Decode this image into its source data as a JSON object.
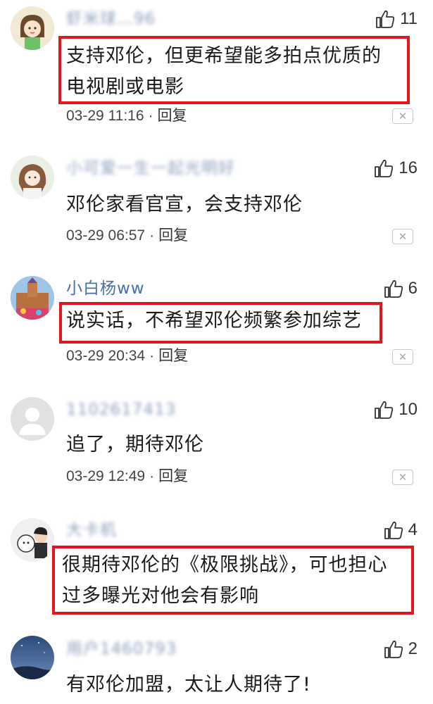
{
  "comments": [
    {
      "username": "虾米球…96",
      "username_blurred": true,
      "likes": "11",
      "text": "支持邓伦，但更希望能多拍点优质的电视剧或电影",
      "date": "03-29 11:16",
      "reply": "回复",
      "highlighted": true,
      "avatar_icon": "cartoon-girl-avatar-icon"
    },
    {
      "username": "小可爱一生一起光明好",
      "username_blurred": true,
      "likes": "16",
      "text": "邓伦家看官宣，会支持邓伦",
      "date": "03-29 06:57",
      "reply": "回复",
      "highlighted": false,
      "avatar_icon": "anime-girl-avatar-icon"
    },
    {
      "username": "小白杨ww",
      "username_blurred": false,
      "likes": "6",
      "text": "说实话，不希望邓伦频繁参加综艺",
      "date": "03-29 20:34",
      "reply": "回复",
      "highlighted": true,
      "avatar_icon": "castle-photo-avatar-icon"
    },
    {
      "username": "1102617413",
      "username_blurred": true,
      "likes": "10",
      "text": "追了，期待邓伦",
      "date": "03-29 12:49",
      "reply": "回复",
      "highlighted": false,
      "avatar_icon": "default-user-avatar-icon"
    },
    {
      "username": "大卡机",
      "username_blurred": true,
      "likes": "4",
      "text": "很期待邓伦的《极限挑战》，可也担心过多曝光对他会有影响",
      "date": "",
      "reply": "",
      "highlighted": true,
      "avatar_icon": "cartoon-boy-avatar-icon"
    },
    {
      "username": "用户1460793",
      "username_blurred": true,
      "likes": "2",
      "text": "有邓伦加盟，太让人期待了!",
      "date": "",
      "reply": "",
      "highlighted": false,
      "avatar_icon": "night-sky-avatar-icon"
    }
  ],
  "colors": {
    "highlight_border": "#e8141c",
    "username_link": "#4a6ea9",
    "meta_text": "#444444"
  },
  "icons": {
    "like": "thumbs-up-icon",
    "dismiss": "close-icon"
  }
}
